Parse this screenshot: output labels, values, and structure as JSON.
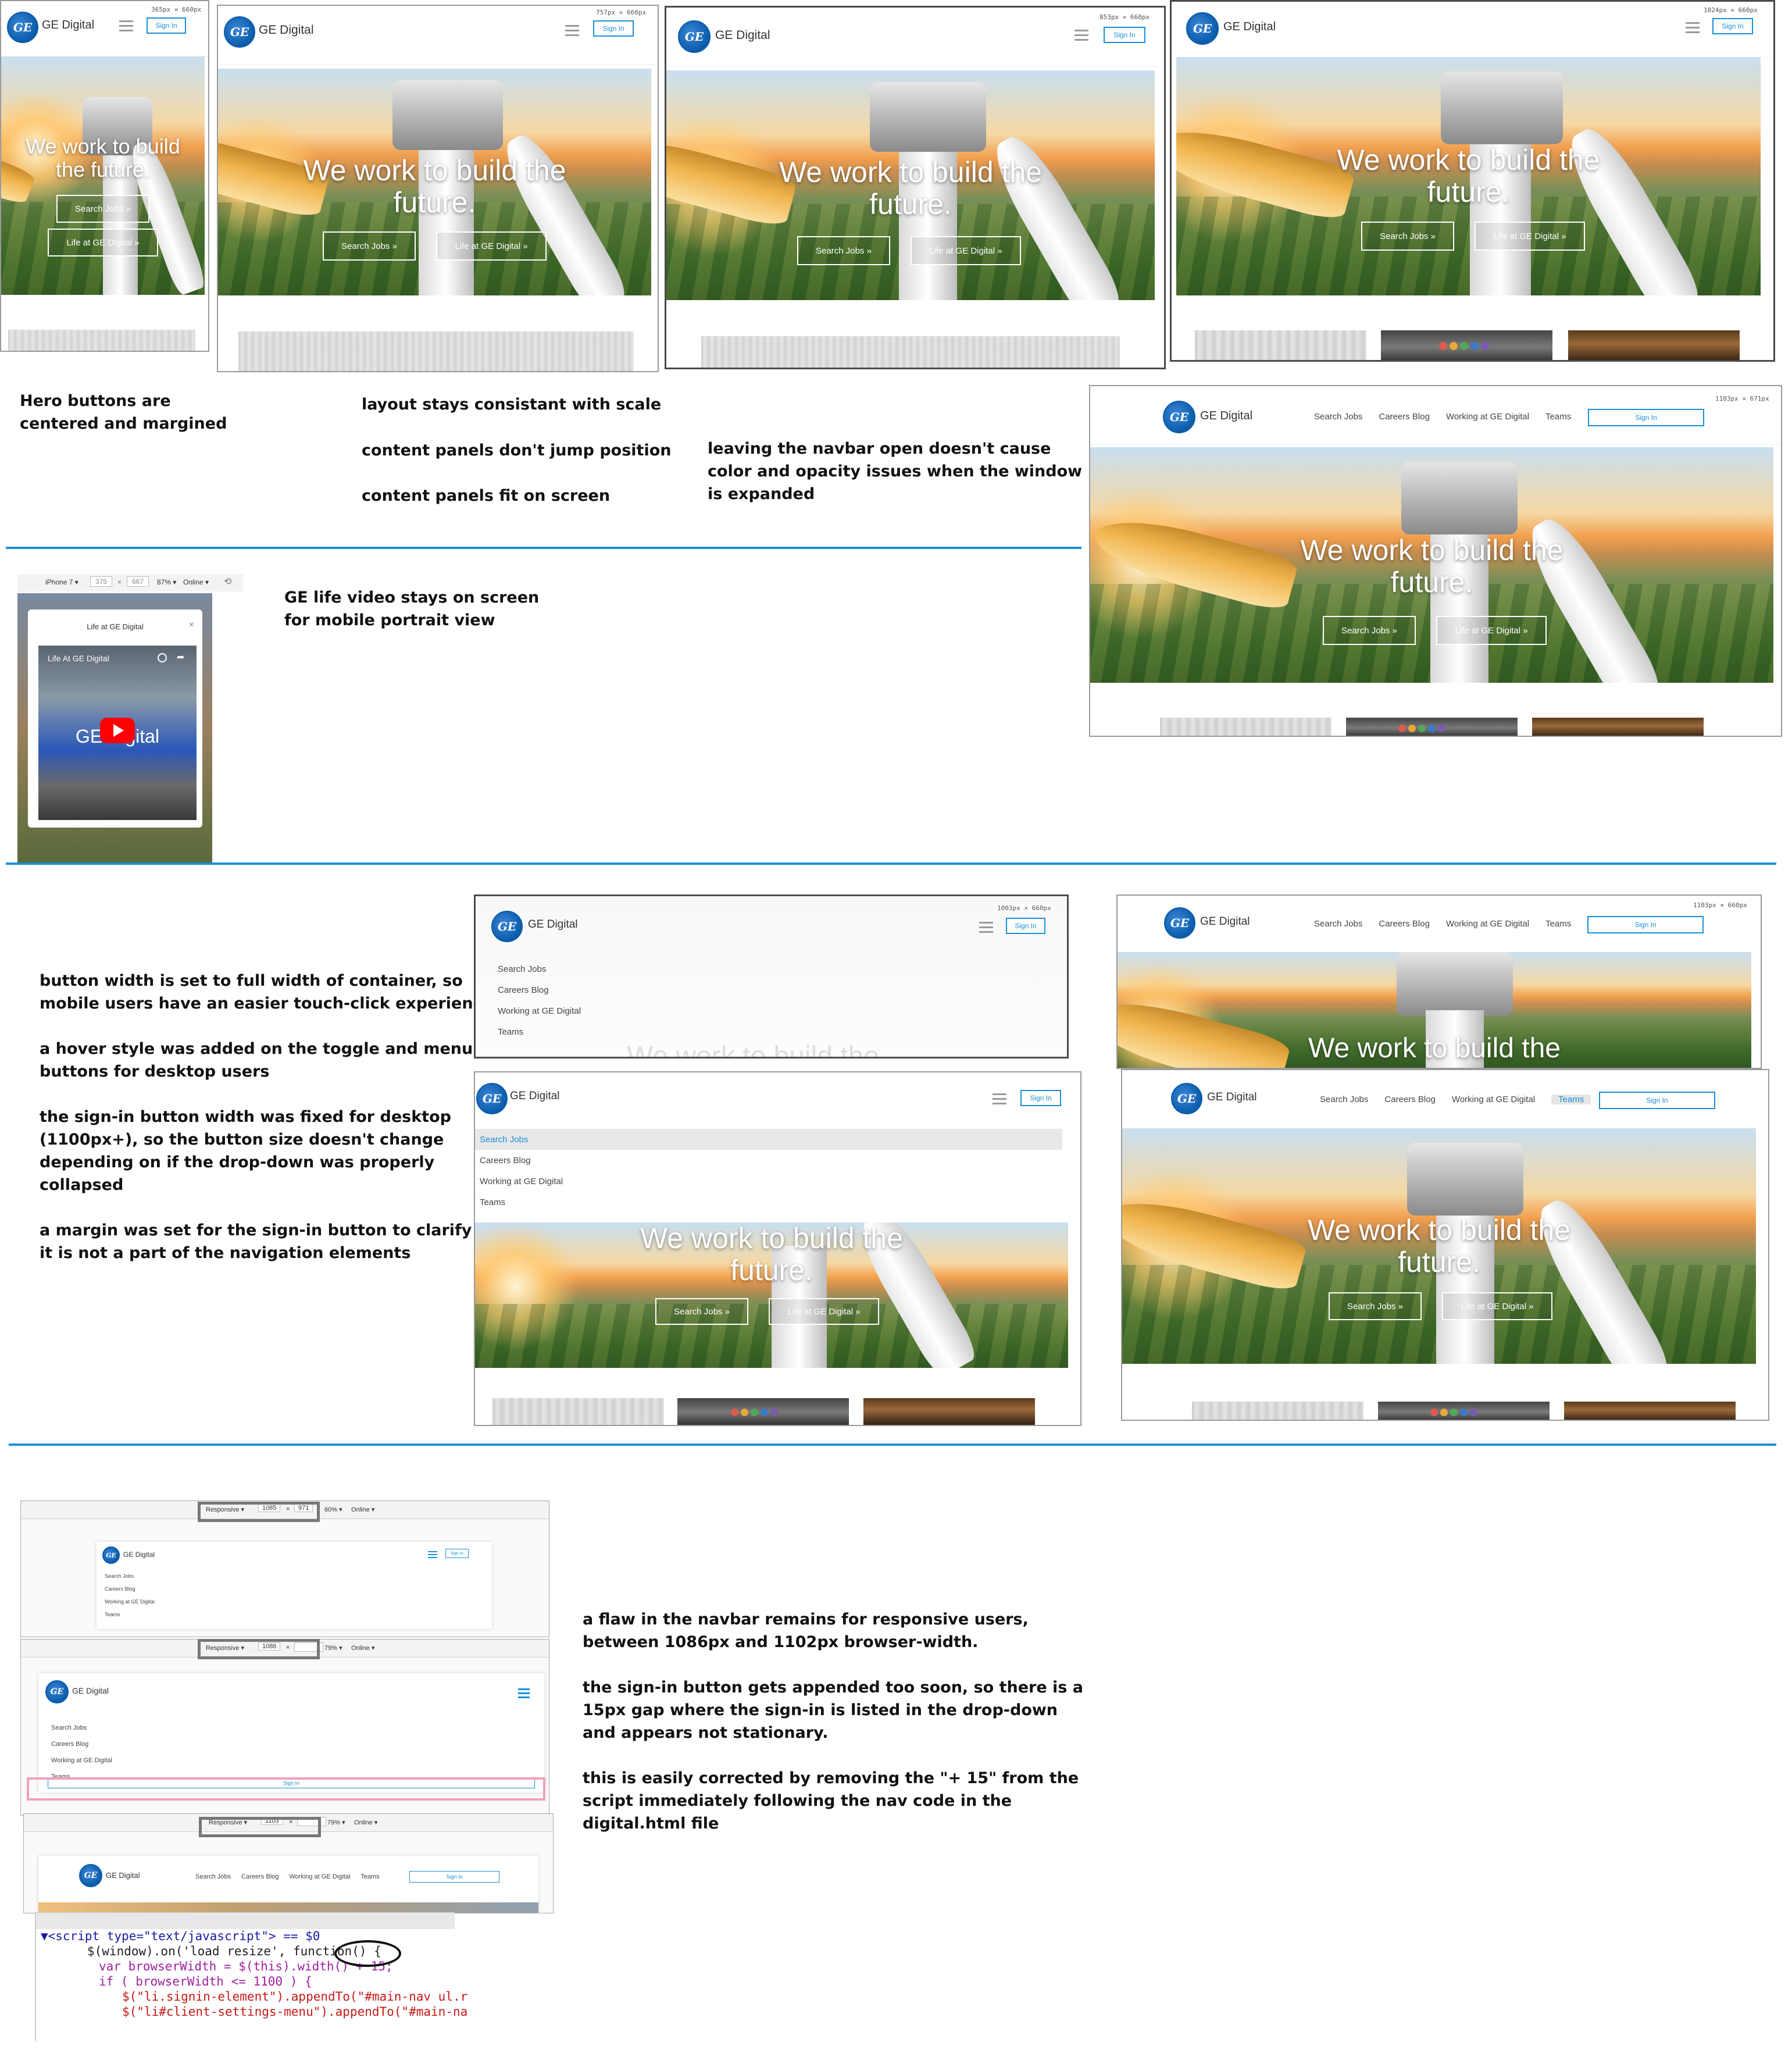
{
  "brand": {
    "name": "GE Digital",
    "logo_text": "GE"
  },
  "nav": {
    "signin": "Sign In",
    "links": [
      "Search Jobs",
      "Careers Blog",
      "Working at GE Digital",
      "Teams"
    ]
  },
  "hero": {
    "headline_wide": "We work to build the future.",
    "headline_line1": "We work to build the",
    "headline_line2": "future.",
    "mobile_line1": "We work to build",
    "mobile_line2": "the future.",
    "btn_jobs": "Search Jobs »",
    "btn_life": "Life at GE Digital »"
  },
  "sizes": {
    "s1": "365px × 660px",
    "s2": "757px × 660px",
    "s3": "853px × 660px",
    "s4": "1024px × 660px",
    "s5": "1103px × 671px",
    "s6": "1003px × 660px",
    "s7": "1103px × 660px"
  },
  "device": {
    "model": "iPhone 7 ▾",
    "width": "375",
    "times": "×",
    "height": "667",
    "zoom": "87% ▾",
    "network": "Online ▾"
  },
  "video": {
    "modal_title": "Life at GE Digital",
    "close": "×",
    "video_title": "Life At GE Digital",
    "overlay_text": "GE Digital"
  },
  "devtools": {
    "mode": "Responsive ▾",
    "row1": {
      "w": "1085",
      "h": "971",
      "zoom": "60% ▾",
      "net": "Online ▾"
    },
    "row2": {
      "w": "1086",
      "h": "",
      "zoom": "79% ▾",
      "net": "Online ▾"
    },
    "row3": {
      "w": "1103",
      "h": "",
      "zoom": "79% ▾",
      "net": "Online ▾"
    }
  },
  "notes": {
    "n1": [
      "Hero buttons are",
      "centered and margined"
    ],
    "n2a": "layout stays consistant with scale",
    "n2b": "content panels don't jump position",
    "n2c": "content panels fit on screen",
    "n3": [
      "leaving the navbar open doesn't cause",
      "color and opacity issues when the window",
      "is expanded"
    ],
    "n4": [
      "GE life video stays on screen",
      "for mobile portrait view"
    ],
    "n5": [
      "button width is set to full width of container, so",
      "mobile users have an easier touch-click experience",
      "",
      "a hover style was added on the toggle and menu",
      "buttons for desktop users",
      "",
      "the sign-in button width was fixed for desktop",
      "(1100px+), so the button size doesn't change",
      "depending on if the drop-down was properly",
      "collapsed",
      "",
      "a margin was set for the sign-in button to clarify that",
      "it is not a part of the navigation elements"
    ],
    "n6": [
      "a flaw in the navbar remains for responsive users,",
      "between 1086px and 1102px browser-width.",
      "",
      "the sign-in button gets appended too soon, so there is a",
      "15px gap where the sign-in is listed in the drop-down",
      "and appears not stationary.",
      "",
      "this is easily corrected by removing the \"+ 15\" from the",
      "script immediately following the nav code in the",
      "digital.html file"
    ]
  },
  "code": {
    "l1a": "▼<script type=\"text/javascript\"> == $0",
    "l2": "$(window).on('load resize', function() {",
    "l3": "var browserWidth = $(this).width() + 15;",
    "l4": "if ( browserWidth <= 1100 ) {",
    "l5": "$(\"li.signin-element\").appendTo(\"#main-nav ul.r",
    "l6": "$(\"li#client-settings-menu\").appendTo(\"#main-na"
  }
}
